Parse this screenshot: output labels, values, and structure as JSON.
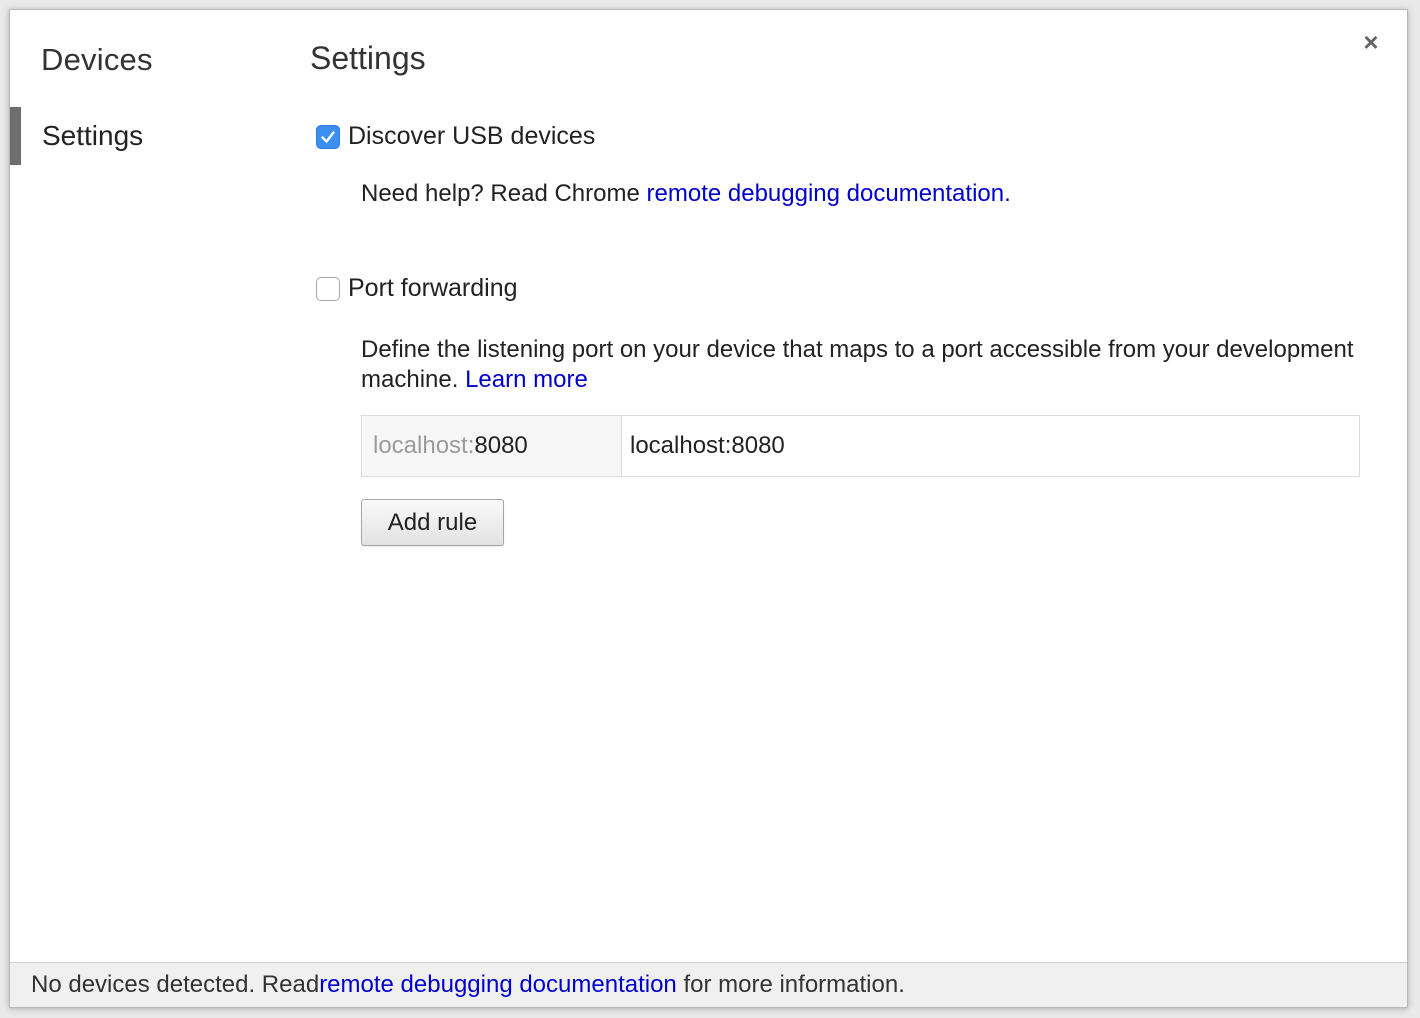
{
  "sidebar": {
    "title": "Devices",
    "items": [
      {
        "label": "Settings",
        "selected": true
      }
    ]
  },
  "close": {
    "icon": "close-icon",
    "glyph": "×"
  },
  "main": {
    "title": "Settings",
    "discover_usb": {
      "label": "Discover USB devices",
      "checked": true,
      "help_prefix": "Need help? Read Chrome ",
      "help_link": "remote debugging documentation."
    },
    "port_forwarding": {
      "label": "Port forwarding",
      "checked": false,
      "description": "Define the listening port on your device that maps to a port accessible from your development machine. ",
      "learn_more": "Learn more",
      "rule": {
        "port_prefix": "localhost:",
        "port_value": "8080",
        "address": "localhost:8080"
      },
      "add_rule_label": "Add rule"
    }
  },
  "footer": {
    "prefix": "No devices detected. Read ",
    "link": "remote debugging documentation",
    "suffix": " for more information."
  },
  "colors": {
    "accent": "#3b8ef2",
    "link": "#0000cc",
    "sidebar_indicator": "#6e6e6e"
  }
}
